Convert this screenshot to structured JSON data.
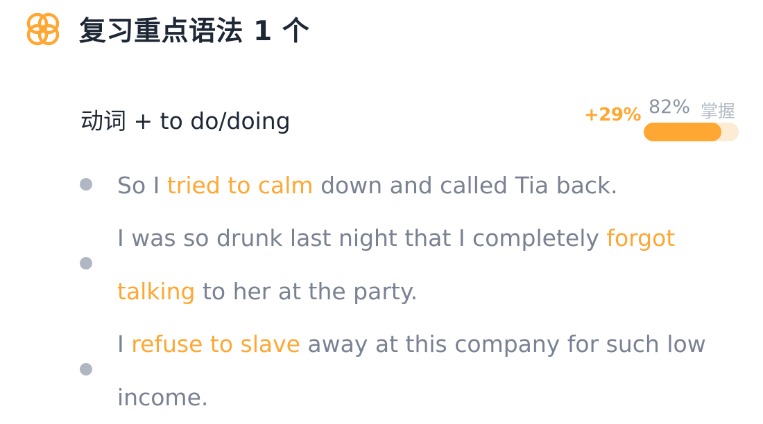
{
  "header": {
    "icon": "clover-ring-icon",
    "title": "复习重点语法 1 个"
  },
  "grammar": {
    "title": "动词 + to do/doing",
    "delta": "+29%",
    "mastery_percent": "82%",
    "mastery_label": "掌握",
    "mastery_fraction": 0.82
  },
  "examples": [
    {
      "before": "So I ",
      "highlight": "tried to calm",
      "after": " down and called Tia back."
    },
    {
      "before": "I was so drunk last night that I completely ",
      "highlight": "forgot talking",
      "after": " to her at the party."
    },
    {
      "before": "I ",
      "highlight": "refuse to slave",
      "after": " away at this company for such low income."
    }
  ],
  "colors": {
    "accent": "#ffa733",
    "accent_light": "#fdebd3",
    "title": "#1e2735",
    "body_text": "#7a8192",
    "bullet": "#b1b7c2"
  }
}
